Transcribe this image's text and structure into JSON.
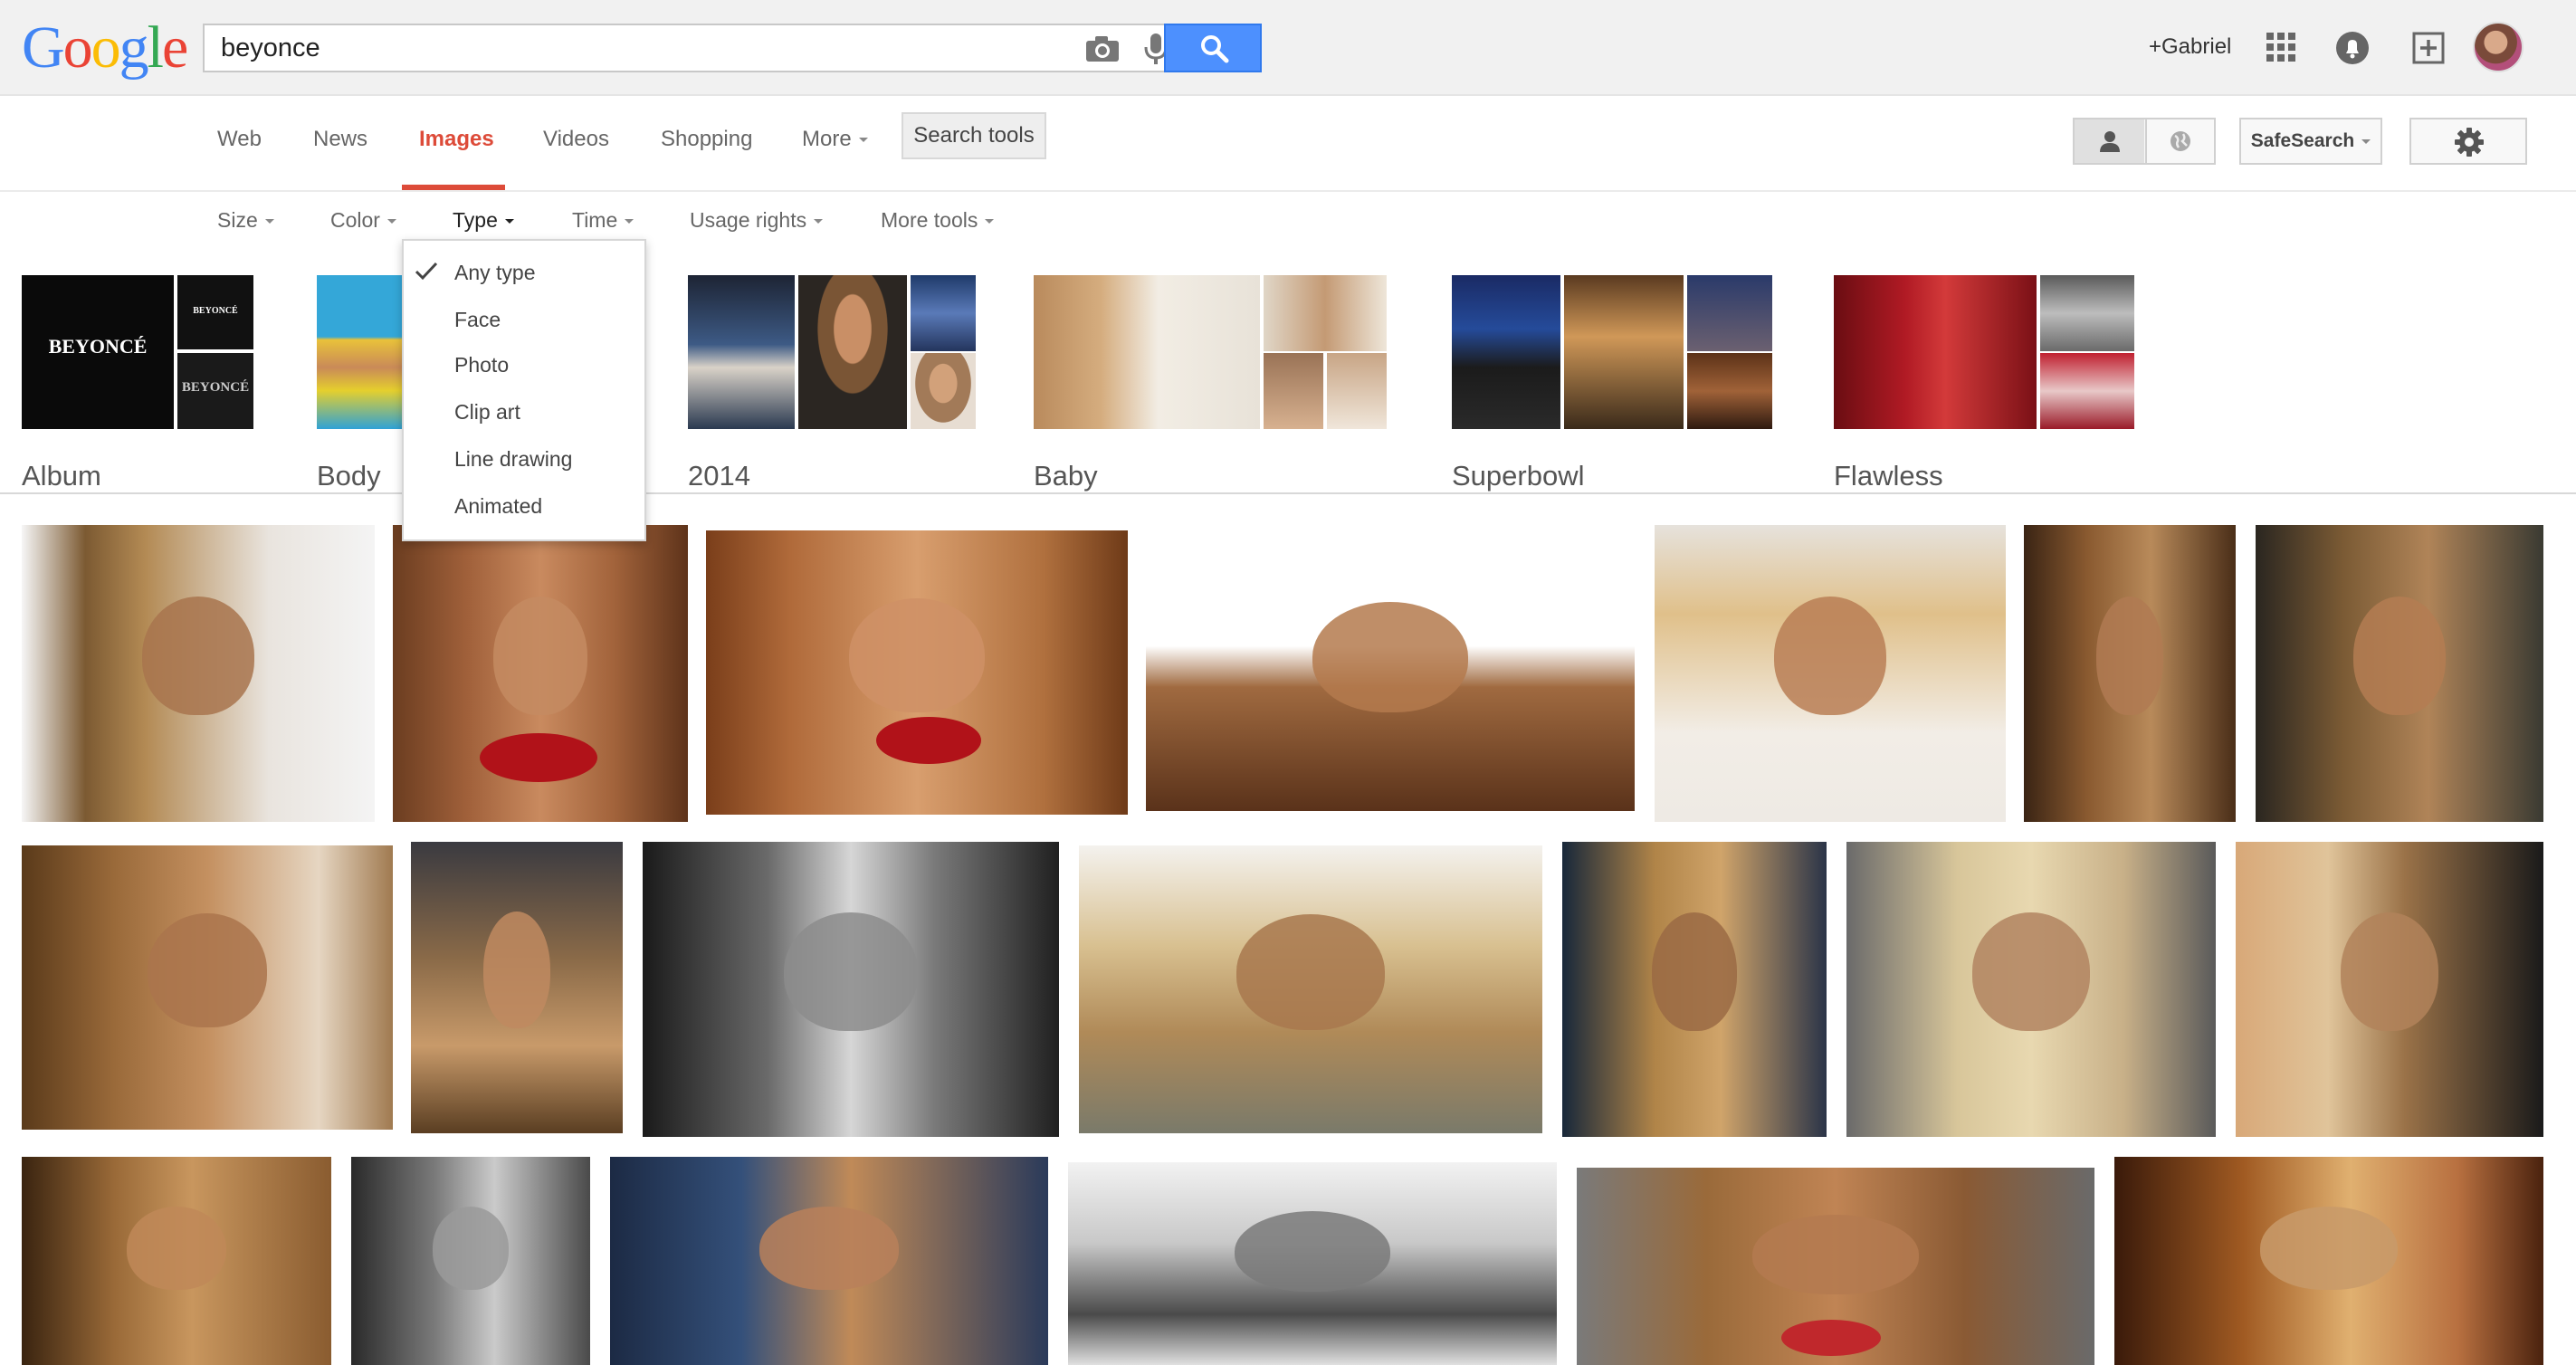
{
  "logo": {
    "letters": [
      "G",
      "o",
      "o",
      "g",
      "l",
      "e"
    ]
  },
  "search": {
    "query": "beyonce"
  },
  "header": {
    "profile_name": "+Gabriel"
  },
  "nav": {
    "tabs": [
      {
        "label": "Web"
      },
      {
        "label": "News"
      },
      {
        "label": "Images"
      },
      {
        "label": "Videos"
      },
      {
        "label": "Shopping"
      },
      {
        "label": "More"
      }
    ],
    "active_tab": "Images",
    "search_tools_label": "Search tools",
    "safesearch_label": "SafeSearch"
  },
  "tools": {
    "items": [
      {
        "label": "Size"
      },
      {
        "label": "Color"
      },
      {
        "label": "Type"
      },
      {
        "label": "Time"
      },
      {
        "label": "Usage rights"
      },
      {
        "label": "More tools"
      }
    ],
    "active_tool": "Type",
    "type_menu": {
      "options": [
        {
          "label": "Any type"
        },
        {
          "label": "Face"
        },
        {
          "label": "Photo"
        },
        {
          "label": "Clip art"
        },
        {
          "label": "Line drawing"
        },
        {
          "label": "Animated"
        }
      ],
      "selected": "Any type"
    }
  },
  "related": {
    "items": [
      {
        "label": "Album"
      },
      {
        "label": "Body"
      },
      {
        "label": "2014"
      },
      {
        "label": "Baby"
      },
      {
        "label": "Superbowl"
      },
      {
        "label": "Flawless"
      }
    ],
    "album_cover_text": "BEYONCÉ"
  },
  "results": {
    "row_count": 3,
    "image_count": 20
  },
  "colors": {
    "accent_red": "#dd4b39",
    "search_blue": "#4d90fe",
    "header_bg": "#f1f1f1"
  },
  "icons": [
    "camera-icon",
    "mic-icon",
    "search-icon",
    "apps-icon",
    "notifications-icon",
    "share-icon",
    "person-icon",
    "globe-icon",
    "gear-icon",
    "check-icon"
  ]
}
